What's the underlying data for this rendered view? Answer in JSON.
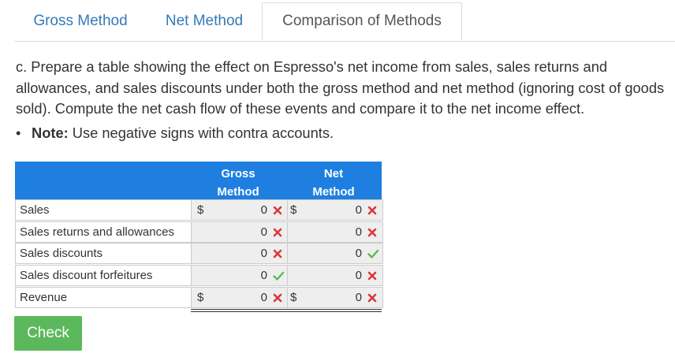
{
  "tabs": [
    {
      "label": "Gross Method",
      "active": false
    },
    {
      "label": "Net Method",
      "active": false
    },
    {
      "label": "Comparison of Methods",
      "active": true
    }
  ],
  "question": {
    "text": "c. Prepare a table showing the effect on Espresso's net income from sales, sales returns and allowances, and sales discounts under both the gross method and net method (ignoring cost of goods sold). Compute the net cash flow of these events and compare it to the net income effect.",
    "note_bullet": "•",
    "note_label": "Note:",
    "note_text": " Use negative signs with contra accounts."
  },
  "table": {
    "header_gross_line1": "Gross",
    "header_gross_line2": "Method",
    "header_net_line1": "Net",
    "header_net_line2": "Method",
    "currency_symbol": "$",
    "rows": [
      {
        "label": "Sales",
        "gross": "0",
        "gross_status": "incorrect",
        "net": "0",
        "net_status": "incorrect",
        "show_dollar": true
      },
      {
        "label": "Sales returns and allowances",
        "gross": "0",
        "gross_status": "incorrect",
        "net": "0",
        "net_status": "incorrect",
        "show_dollar": false
      },
      {
        "label": "Sales discounts",
        "gross": "0",
        "gross_status": "incorrect",
        "net": "0",
        "net_status": "correct",
        "show_dollar": false
      },
      {
        "label": "Sales discount forfeitures",
        "gross": "0",
        "gross_status": "correct",
        "net": "0",
        "net_status": "incorrect",
        "show_dollar": false
      },
      {
        "label": "Revenue",
        "gross": "0",
        "gross_status": "incorrect",
        "net": "0",
        "net_status": "incorrect",
        "show_dollar": true
      }
    ]
  },
  "check_button": "Check",
  "colors": {
    "header_blue": "#1e7fe0",
    "tab_link": "#337ab7",
    "incorrect_red": "#d9383a",
    "correct_green": "#5cb85c",
    "check_button_green": "#5cb85c"
  },
  "icons": {
    "correct": "check-mark-icon",
    "incorrect": "x-mark-icon"
  }
}
